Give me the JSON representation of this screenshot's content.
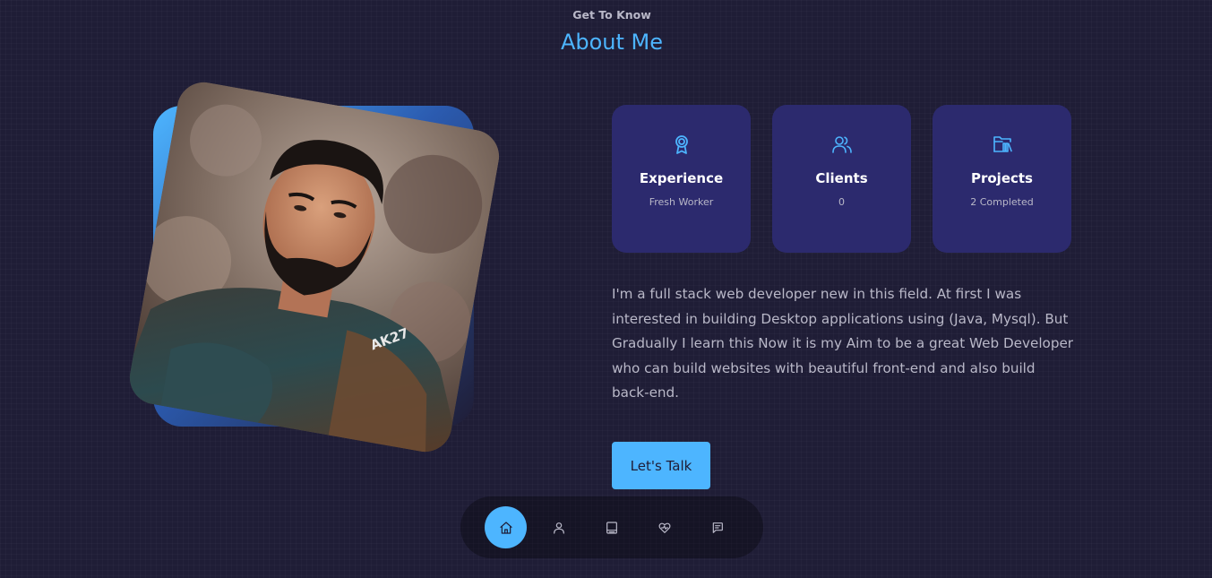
{
  "header": {
    "subtitle": "Get To Know",
    "title": "About Me"
  },
  "portrait": {
    "badge_text": "AK27"
  },
  "cards": [
    {
      "icon": "award-icon",
      "title": "Experience",
      "value": "Fresh Worker"
    },
    {
      "icon": "users-icon",
      "title": "Clients",
      "value": "0"
    },
    {
      "icon": "folder-library-icon",
      "title": "Projects",
      "value": "2 Completed"
    }
  ],
  "about_text": "I'm a full stack web developer new in this field. At first I was interested in building Desktop applications using (Java, Mysql). But Gradually I learn this Now it is my Aim to be a great Web Developer who can build websites with beautiful front-end and also build back-end.",
  "cta": {
    "label": "Let's Talk"
  },
  "bottom_nav": {
    "items": [
      {
        "icon": "home-icon",
        "active": true
      },
      {
        "icon": "user-icon",
        "active": false
      },
      {
        "icon": "book-icon",
        "active": false
      },
      {
        "icon": "services-icon",
        "active": false
      },
      {
        "icon": "message-icon",
        "active": false
      }
    ]
  },
  "colors": {
    "background": "#1f1d36",
    "accent": "#4db5ff",
    "card": "#2c2a6e",
    "text_muted": "#b9b8c8"
  }
}
